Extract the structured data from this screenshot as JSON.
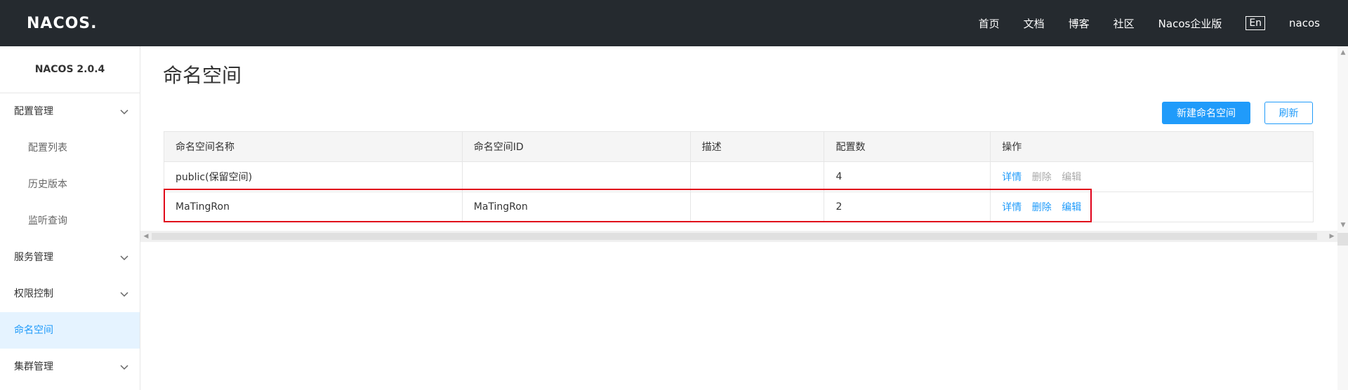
{
  "header": {
    "logo": "NACOS.",
    "nav": [
      "首页",
      "文档",
      "博客",
      "社区",
      "Nacos企业版"
    ],
    "lang": "En",
    "user": "nacos"
  },
  "sidebar": {
    "title": "NACOS 2.0.4",
    "items": [
      {
        "label": "配置管理",
        "type": "group",
        "icon": "chevron-down-icon"
      },
      {
        "label": "配置列表",
        "type": "sub"
      },
      {
        "label": "历史版本",
        "type": "sub"
      },
      {
        "label": "监听查询",
        "type": "sub"
      },
      {
        "label": "服务管理",
        "type": "group",
        "icon": "chevron-down-icon"
      },
      {
        "label": "权限控制",
        "type": "group",
        "icon": "chevron-down-icon"
      },
      {
        "label": "命名空间",
        "type": "active"
      },
      {
        "label": "集群管理",
        "type": "group",
        "icon": "chevron-down-icon"
      }
    ]
  },
  "main": {
    "title": "命名空间",
    "buttons": {
      "create": "新建命名空间",
      "refresh": "刷新"
    },
    "table": {
      "columns": [
        "命名空间名称",
        "命名空间ID",
        "描述",
        "配置数",
        "操作"
      ],
      "rows": [
        {
          "name": "public(保留空间)",
          "id": "",
          "desc": "",
          "count": "4",
          "ops": [
            {
              "label": "详情",
              "state": "link"
            },
            {
              "label": "删除",
              "state": "disabled"
            },
            {
              "label": "编辑",
              "state": "disabled"
            }
          ]
        },
        {
          "name": "MaTingRon",
          "id": "MaTingRon",
          "desc": "",
          "count": "2",
          "ops": [
            {
              "label": "详情",
              "state": "link"
            },
            {
              "label": "删除",
              "state": "link"
            },
            {
              "label": "编辑",
              "state": "link"
            }
          ]
        }
      ]
    }
  },
  "colors": {
    "accent": "#209bfa",
    "topbar": "#252a2f",
    "highlight": "#e0001a",
    "active_bg": "#e5f3ff"
  }
}
